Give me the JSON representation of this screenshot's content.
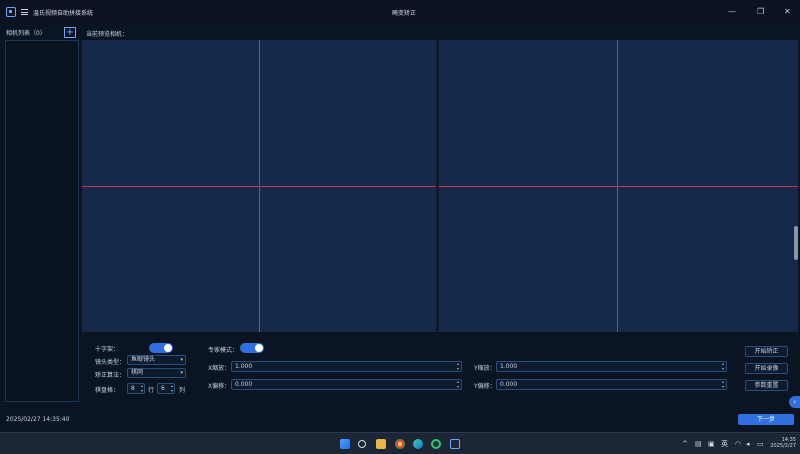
{
  "titlebar": {
    "app_title": "温氏视频自助拼接系统",
    "window_title": "畸变矫正",
    "minimize": "—",
    "maximize": "❐",
    "close": "✕"
  },
  "sidebar": {
    "header": "相机列表（0）",
    "add_label": "+"
  },
  "preview": {
    "label": "当前预览相机："
  },
  "controls": {
    "crosshair_label": "十字架：",
    "crosshair_on": true,
    "lens_type_label": "镜头类型：",
    "lens_type_value": "鱼眼镜头",
    "algorithm_label": "矫正算法：",
    "algorithm_value": "棋网",
    "checkerboard_label": "棋盘格：",
    "rows_value": "8",
    "rows_unit": "行",
    "cols_value": "6",
    "cols_unit": "列",
    "expert_label": "专家模式：",
    "expert_on": true,
    "x_scale_label": "X缩放：",
    "x_scale_value": "1.000",
    "x_offset_label": "X偏移：",
    "x_offset_value": "0.000",
    "y_scale_label": "Y缩放：",
    "y_scale_value": "1.000",
    "y_offset_label": "Y偏移：",
    "y_offset_value": "0.000",
    "start_correction": "开始矫正",
    "start_recording": "开始录像",
    "reset_params": "参数重置"
  },
  "footer": {
    "timestamp": "2025/02/27 14:35:40",
    "next_button": "下一步",
    "collapse_icon": "‹"
  },
  "taskbar": {
    "tray_chevron": "^",
    "tray_lang": "英",
    "clock_time": "14:35",
    "clock_date": "2025/2/27"
  },
  "colors": {
    "accent": "#2f6fe0",
    "crosshair": "#d0304a",
    "preview_bg": "#15294a"
  }
}
